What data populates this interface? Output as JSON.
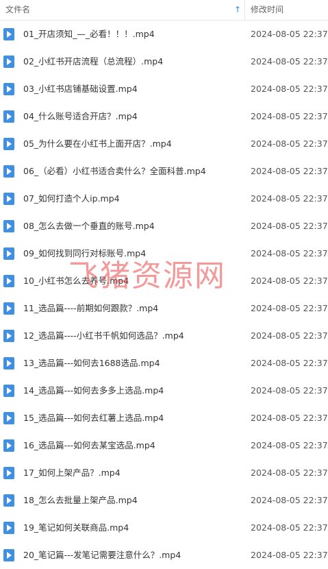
{
  "header": {
    "name_label": "文件名",
    "sort_icon": "↑",
    "time_label": "修改时间"
  },
  "files": [
    {
      "name": "01_开店须知_—_必看！！！.mp4",
      "time": "2024-08-05 22:37"
    },
    {
      "name": "02_小红书开店流程（总流程）.mp4",
      "time": "2024-08-05 22:37"
    },
    {
      "name": "03_小红书店铺基础设置.mp4",
      "time": "2024-08-05 22:37"
    },
    {
      "name": "04_什么账号适合开店？.mp4",
      "time": "2024-08-05 22:37"
    },
    {
      "name": "05_为什么要在小红书上面开店？.mp4",
      "time": "2024-08-05 22:37"
    },
    {
      "name": "06_（必看）小红书适合卖什么？全面科普.mp4",
      "time": "2024-08-05 22:37"
    },
    {
      "name": "07_如何打造个人ip.mp4",
      "time": "2024-08-05 22:37"
    },
    {
      "name": "08_怎么去做一个垂直的账号.mp4",
      "time": "2024-08-05 22:37"
    },
    {
      "name": "09_如何找到同行对标账号.mp4",
      "time": "2024-08-05 22:37"
    },
    {
      "name": "10_小红书怎么去养号.mp4",
      "time": "2024-08-05 22:37"
    },
    {
      "name": "11_选品篇----前期如何跟款？.mp4",
      "time": "2024-08-05 22:37"
    },
    {
      "name": "12_选品篇----小红书千帆如何选品？.mp4",
      "time": "2024-08-05 22:37"
    },
    {
      "name": "13_选品篇---如何去1688选品.mp4",
      "time": "2024-08-05 22:37"
    },
    {
      "name": "14_选品篇---如何去多多上选品.mp4",
      "time": "2024-08-05 22:37"
    },
    {
      "name": "15_选品篇---如何去红薯上选品.mp4",
      "time": "2024-08-05 22:37"
    },
    {
      "name": "16_选品篇---如何去某宝选品.mp4",
      "time": "2024-08-05 22:37"
    },
    {
      "name": "17_如何上架产品？.mp4",
      "time": "2024-08-05 22:37"
    },
    {
      "name": "18_怎么去批量上架产品.mp4",
      "time": "2024-08-05 22:37"
    },
    {
      "name": "19_笔记如何关联商品.mp4",
      "time": "2024-08-05 22:37"
    },
    {
      "name": "20_笔记篇---发笔记需要注意什么？.mp4",
      "time": "2024-08-05 22:37"
    }
  ],
  "watermark": "飞猪资源网",
  "colors": {
    "accent": "#3f8fe4",
    "watermark": "#eb4646"
  },
  "icons": {
    "file": "video-file-icon",
    "sort": "sort-ascending-icon"
  }
}
